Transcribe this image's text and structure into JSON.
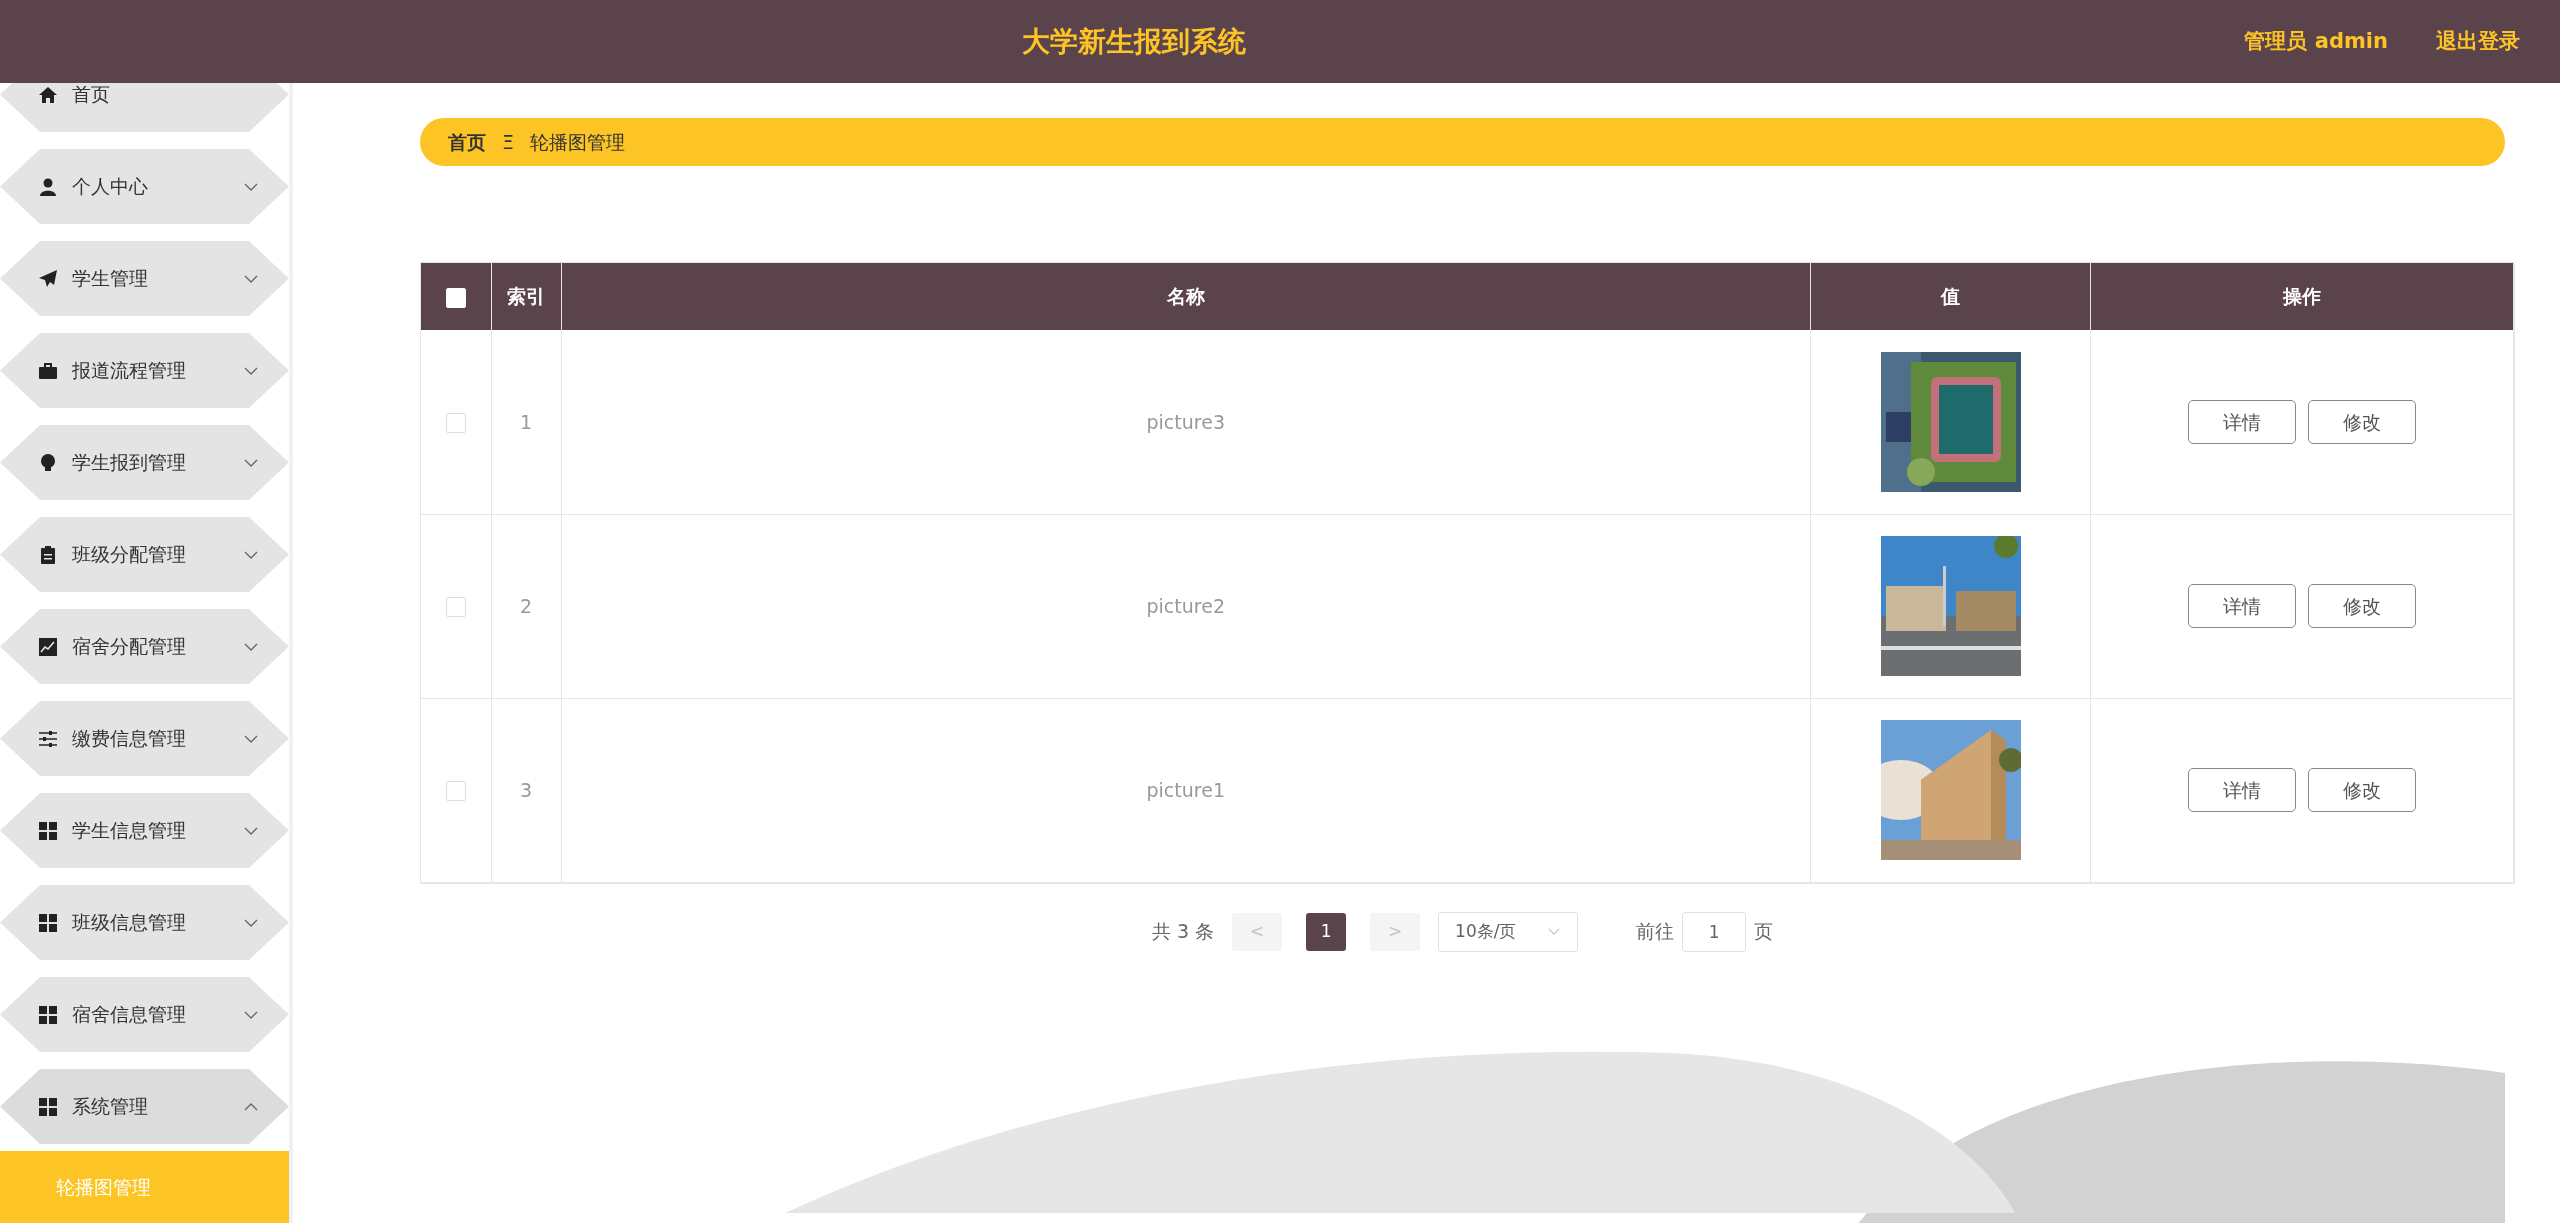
{
  "header": {
    "title": "大学新生报到系统",
    "user_label": "管理员 admin",
    "logout": "退出登录"
  },
  "sidebar": {
    "items": [
      {
        "label": "首页"
      },
      {
        "label": "个人中心",
        "expanded": false
      },
      {
        "label": "学生管理",
        "expanded": false
      },
      {
        "label": "报道流程管理",
        "expanded": false
      },
      {
        "label": "学生报到管理",
        "expanded": false
      },
      {
        "label": "班级分配管理",
        "expanded": false
      },
      {
        "label": "宿舍分配管理",
        "expanded": false
      },
      {
        "label": "缴费信息管理",
        "expanded": false
      },
      {
        "label": "学生信息管理",
        "expanded": false
      },
      {
        "label": "班级信息管理",
        "expanded": false
      },
      {
        "label": "宿舍信息管理",
        "expanded": false
      },
      {
        "label": "系统管理",
        "expanded": true,
        "children": [
          {
            "label": "轮播图管理",
            "selected": true
          }
        ]
      }
    ]
  },
  "breadcrumb": {
    "home": "首页",
    "separator": "Ξ",
    "current": "轮播图管理"
  },
  "table": {
    "select_all_checked": false,
    "columns": [
      "索引",
      "名称",
      "值",
      "操作"
    ],
    "rows": [
      {
        "checked": false,
        "index": "1",
        "name": "picture3",
        "actions": [
          "详情",
          "修改"
        ]
      },
      {
        "checked": false,
        "index": "2",
        "name": "picture2",
        "actions": [
          "详情",
          "修改"
        ]
      },
      {
        "checked": false,
        "index": "3",
        "name": "picture1",
        "actions": [
          "详情",
          "修改"
        ]
      }
    ]
  },
  "pagination": {
    "total": "共 3 条",
    "prev": {
      "label": "<",
      "disabled": true
    },
    "pages": [
      {
        "label": "1",
        "selected": true
      }
    ],
    "next": {
      "label": ">",
      "disabled": true
    },
    "page_size": "10条/页",
    "goto_label": "前往",
    "goto_value": "1",
    "goto_suffix": "页"
  }
}
